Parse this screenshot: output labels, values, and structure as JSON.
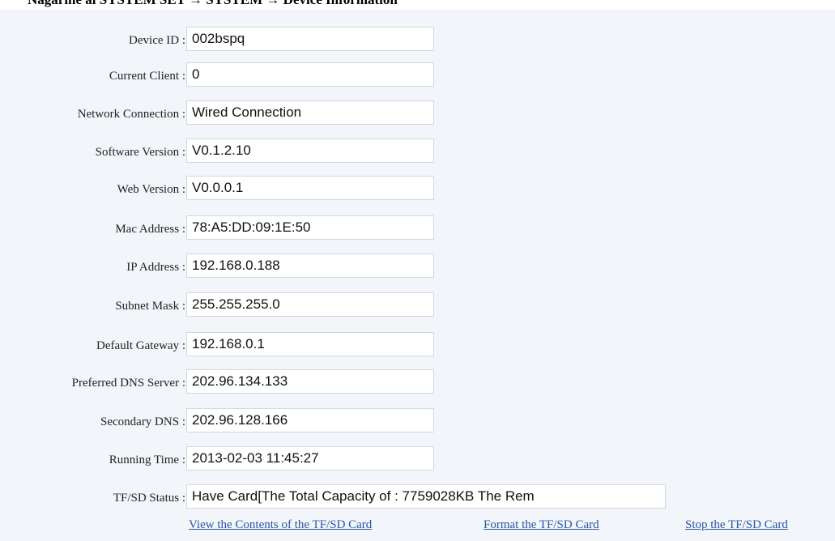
{
  "breadcrumb": "Nagarine ai SYSTEM SET → SYSTEM → Device Information",
  "fields": [
    {
      "label": "Device ID :",
      "value": "002bspq"
    },
    {
      "label": "Current Client :",
      "value": "0"
    },
    {
      "label": "Network Connection :",
      "value": "Wired Connection"
    },
    {
      "label": "Software Version :",
      "value": "V0.1.2.10"
    },
    {
      "label": "Web Version :",
      "value": "V0.0.0.1"
    },
    {
      "label": "Mac Address :",
      "value": "78:A5:DD:09:1E:50"
    },
    {
      "label": "IP Address :",
      "value": "192.168.0.188"
    },
    {
      "label": "Subnet Mask :",
      "value": "255.255.255.0"
    },
    {
      "label": "Default Gateway :",
      "value": "192.168.0.1"
    },
    {
      "label": "Preferred DNS Server :",
      "value": "202.96.134.133"
    },
    {
      "label": "Secondary DNS :",
      "value": "202.96.128.166"
    },
    {
      "label": "Running Time :",
      "value": "2013-02-03 11:45:27"
    },
    {
      "label": "TF/SD Status :",
      "value": "Have Card[The Total Capacity of : 7759028KB The Rem"
    }
  ],
  "links": {
    "view_contents": "View the Contents of the TF/SD Card",
    "format": "Format the TF/SD Card",
    "stop": "Stop the TF/SD Card"
  }
}
